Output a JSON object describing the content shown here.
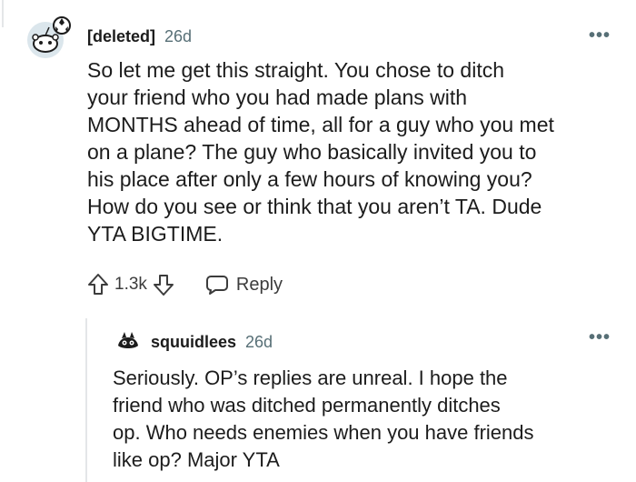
{
  "comment": {
    "author": "[deleted]",
    "age": "26d",
    "more_label": "•••",
    "body_lines": [
      "So let me get this straight. You chose to ditch",
      "your friend who you had made plans with",
      "MONTHS ahead of time, all for a guy who you met",
      "on a plane? The guy who basically invited you to",
      "his place after only a few hours of knowing you?",
      "How do you see or think that you aren’t TA. Dude",
      "YTA BIGTIME."
    ],
    "score": "1.3k",
    "reply_label": "Reply",
    "icons": [
      "reddit-snoo-avatar",
      "upvote-arrow-icon",
      "downvote-arrow-icon",
      "reply-bubble-icon",
      "overflow-menu-icon"
    ]
  },
  "reply": {
    "author": "squuidlees",
    "age": "26d",
    "more_label": "•••",
    "body_lines": [
      "Seriously. OP’s replies are unreal. I hope the",
      "friend who was ditched permanently ditches",
      "op. Who needs enemies when you have friends",
      "like op? Major YTA"
    ]
  },
  "colors": {
    "text": "#1c1c1c",
    "meta": "#576f76",
    "thread_line": "#e4e6e8",
    "avatar_bg": "#dbe6ec"
  }
}
